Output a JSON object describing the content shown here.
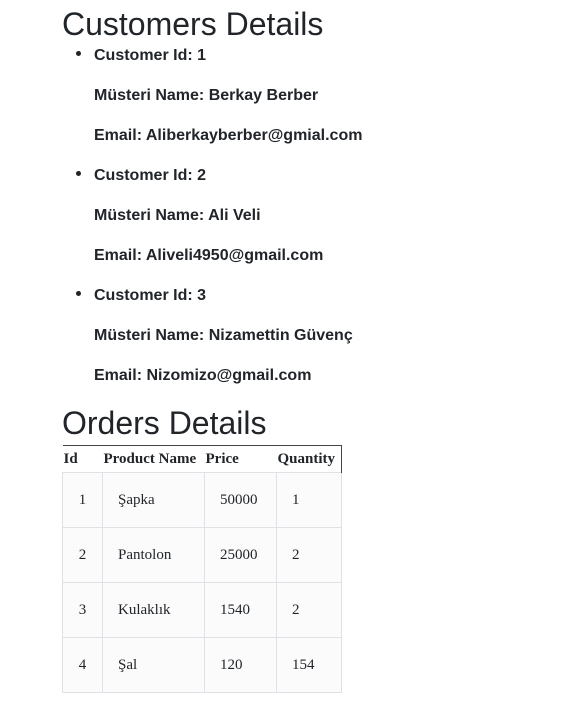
{
  "customers_section": {
    "title": "Customers Details",
    "customers": [
      {
        "id_line": "Customer Id: 1",
        "name_line": "Müsteri Name: Berkay Berber",
        "email_line": "Email: Aliberkayberber@gmial.com"
      },
      {
        "id_line": "Customer Id: 2",
        "name_line": "Müsteri Name: Ali Veli",
        "email_line": "Email: Aliveli4950@gmail.com"
      },
      {
        "id_line": "Customer Id: 3",
        "name_line": "Müsteri Name: Nizamettin Güvenç",
        "email_line": "Email: Nizomizo@gmail.com"
      }
    ]
  },
  "orders_section": {
    "title": "Orders Details",
    "headers": [
      "Id",
      "Product Name",
      "Price",
      "Quantity"
    ],
    "rows": [
      [
        "1",
        "Şapka",
        "50000",
        "1"
      ],
      [
        "2",
        "Pantolon",
        "25000",
        "2"
      ],
      [
        "3",
        "Kulaklık",
        "1540",
        "2"
      ],
      [
        "4",
        "Şal",
        "120",
        "154"
      ]
    ]
  }
}
